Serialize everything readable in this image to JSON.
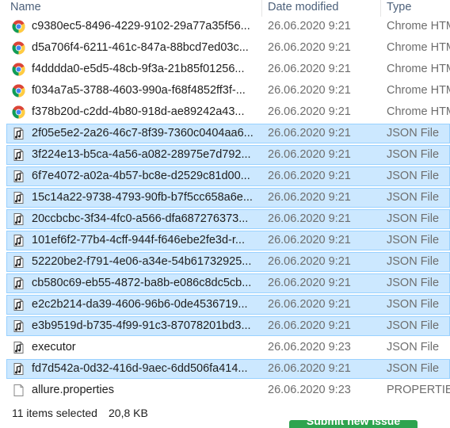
{
  "columns": {
    "name": "Name",
    "date": "Date modified",
    "type": "Type"
  },
  "files": [
    {
      "name": "c9380ec5-8496-4229-9102-29a77a35f56...",
      "date": "26.06.2020 9:21",
      "type": "Chrome HTML Document",
      "icon": "chrome-icon",
      "selected": false
    },
    {
      "name": "d5a706f4-6211-461c-847a-88bcd7ed03c...",
      "date": "26.06.2020 9:21",
      "type": "Chrome HTML Document",
      "icon": "chrome-icon",
      "selected": false
    },
    {
      "name": "f4dddda0-e5d5-48cb-9f3a-21b85f01256...",
      "date": "26.06.2020 9:21",
      "type": "Chrome HTML Document",
      "icon": "chrome-icon",
      "selected": false
    },
    {
      "name": "f034a7a5-3788-4603-990a-f68f4852ff3f-...",
      "date": "26.06.2020 9:21",
      "type": "Chrome HTML Document",
      "icon": "chrome-icon",
      "selected": false
    },
    {
      "name": "f378b20d-c2dd-4b80-918d-ae89242a43...",
      "date": "26.06.2020 9:21",
      "type": "Chrome HTML Document",
      "icon": "chrome-icon",
      "selected": false
    },
    {
      "name": "2f05e5e2-2a26-46c7-8f39-7360c0404aa6...",
      "date": "26.06.2020 9:21",
      "type": "JSON File",
      "icon": "json-file-icon",
      "selected": true
    },
    {
      "name": "3f224e13-b5ca-4a56-a082-28975e7d792...",
      "date": "26.06.2020 9:21",
      "type": "JSON File",
      "icon": "json-file-icon",
      "selected": true
    },
    {
      "name": "6f7e4072-a02a-4b57-bc8e-d2529c81d00...",
      "date": "26.06.2020 9:21",
      "type": "JSON File",
      "icon": "json-file-icon",
      "selected": true
    },
    {
      "name": "15c14a22-9738-4793-90fb-b7f5cc658a6e...",
      "date": "26.06.2020 9:21",
      "type": "JSON File",
      "icon": "json-file-icon",
      "selected": true
    },
    {
      "name": "20ccbcbc-3f34-4fc0-a566-dfa687276373...",
      "date": "26.06.2020 9:21",
      "type": "JSON File",
      "icon": "json-file-icon",
      "selected": true
    },
    {
      "name": "101ef6f2-77b4-4cff-944f-f646ebe2fe3d-r...",
      "date": "26.06.2020 9:21",
      "type": "JSON File",
      "icon": "json-file-icon",
      "selected": true
    },
    {
      "name": "52220be2-f791-4e06-a34e-54b61732925...",
      "date": "26.06.2020 9:21",
      "type": "JSON File",
      "icon": "json-file-icon",
      "selected": true
    },
    {
      "name": "cb580c69-eb55-4872-ba8b-e086c8dc5cb...",
      "date": "26.06.2020 9:21",
      "type": "JSON File",
      "icon": "json-file-icon",
      "selected": true
    },
    {
      "name": "e2c2b214-da39-4606-96b6-0de4536719...",
      "date": "26.06.2020 9:21",
      "type": "JSON File",
      "icon": "json-file-icon",
      "selected": true
    },
    {
      "name": "e3b9519d-b735-4f99-91c3-87078201bd3...",
      "date": "26.06.2020 9:21",
      "type": "JSON File",
      "icon": "json-file-icon",
      "selected": true
    },
    {
      "name": "executor",
      "date": "26.06.2020 9:23",
      "type": "JSON File",
      "icon": "json-file-icon",
      "selected": false
    },
    {
      "name": "fd7d542a-0d32-416d-9aec-6dd506fa414...",
      "date": "26.06.2020 9:21",
      "type": "JSON File",
      "icon": "json-file-icon",
      "selected": true
    },
    {
      "name": "allure.properties",
      "date": "26.06.2020 9:23",
      "type": "PROPERTIES File",
      "icon": "blank-file-icon",
      "selected": false
    }
  ],
  "status": {
    "count": "11 items selected",
    "size": "20,8 KB"
  },
  "background_button": {
    "label": "Submit new issue"
  },
  "colors": {
    "selection_fill": "#cce8ff",
    "selection_border": "#99d1ff",
    "header_text": "#4c607a",
    "meta_text": "#6d6d6d",
    "button_green": "#2ea44f"
  }
}
